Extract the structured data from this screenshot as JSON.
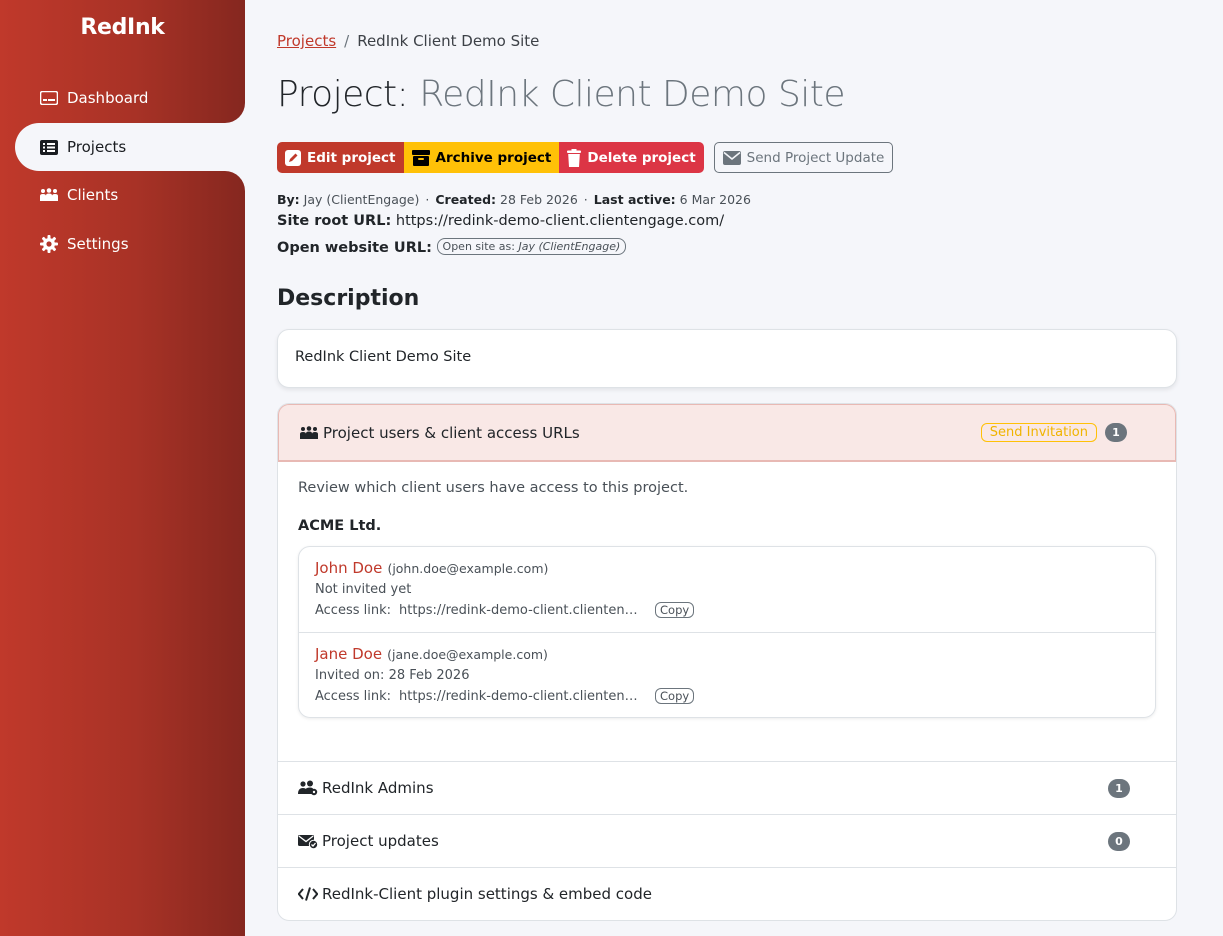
{
  "app": {
    "brand": "RedInk"
  },
  "sidebar": {
    "items": [
      {
        "label": "Dashboard",
        "icon": "dashboard-icon"
      },
      {
        "label": "Projects",
        "icon": "list-icon"
      },
      {
        "label": "Clients",
        "icon": "people-icon"
      },
      {
        "label": "Settings",
        "icon": "gear-icon"
      }
    ]
  },
  "breadcrumb": {
    "root": "Projects",
    "separator": "/",
    "current": "RedInk Client Demo Site"
  },
  "page": {
    "title_prefix": "Project:",
    "title_name": "RedInk Client Demo Site"
  },
  "actions": {
    "edit": "Edit project",
    "archive": "Archive project",
    "delete": "Delete project",
    "send_update": "Send Project Update"
  },
  "meta": {
    "by_label": "By:",
    "by_value": "Jay (ClientEngage)",
    "created_label": "Created:",
    "created_value": "28 Feb 2026",
    "last_active_label": "Last active:",
    "last_active_value": "6 Mar 2026",
    "dot": "·"
  },
  "site": {
    "root_label": "Site root URL:",
    "root_value": "https://redink-demo-client.clientengage.com/",
    "open_label": "Open website URL:",
    "open_pill_prefix": "Open site as:",
    "open_pill_user": "Jay (ClientEngage)"
  },
  "description": {
    "heading": "Description",
    "text": "RedInk Client Demo Site"
  },
  "users_section": {
    "title": "Project users & client access URLs",
    "send_invitation": "Send Invitation",
    "count": "1",
    "lead": "Review which client users have access to this project.",
    "company": "ACME Ltd.",
    "access_label": "Access link:",
    "copy_label": "Copy",
    "users": [
      {
        "name": "John Doe",
        "email": "(john.doe@example.com)",
        "status": "Not invited yet",
        "link": "https://redink-demo-client.clientengage.com/"
      },
      {
        "name": "Jane Doe",
        "email": "(jane.doe@example.com)",
        "status": "Invited on: 28 Feb 2026",
        "link": "https://redink-demo-client.clientengage.com/"
      }
    ]
  },
  "sections": {
    "admins": {
      "title": "RedInk Admins",
      "count": "1"
    },
    "updates": {
      "title": "Project updates",
      "count": "0"
    },
    "plugin": {
      "title": "RedInk-Client plugin settings & embed code"
    }
  },
  "colors": {
    "brand": "#c0392b",
    "warning": "#ffc107",
    "danger": "#dc3545",
    "muted": "#6c757d"
  }
}
